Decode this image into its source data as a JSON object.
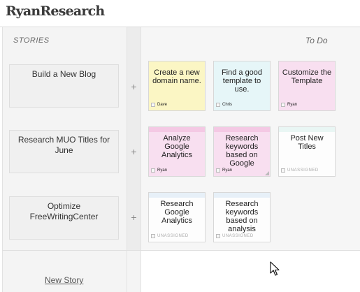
{
  "app": {
    "logo": "RyanResearch"
  },
  "board": {
    "stories_header": "STORIES",
    "todo_header": "To Do",
    "add_symbol": "+",
    "new_story_label": "New Story"
  },
  "stories": [
    {
      "title": "Build a New Blog",
      "cards": [
        {
          "text": "Create a new domain name.",
          "owner": "Dave",
          "color": "#fbf6c4"
        },
        {
          "text": "Find a good template to use.",
          "owner": "Chris",
          "color": "#e6f6f8"
        },
        {
          "text": "Customize the Template",
          "owner": "Ryan",
          "color": "#f8dff0"
        }
      ]
    },
    {
      "title": "Research MUO Titles for June",
      "cards": [
        {
          "text": "Analyze Google Analytics",
          "owner": "Ryan",
          "color": "#f8dff0"
        },
        {
          "text": "Research keywords based on Google",
          "owner": "Ryan",
          "color": "#f8dff0"
        },
        {
          "text": "Post New Titles",
          "owner": "UNASSIGNED",
          "color": "#fdfdfd"
        }
      ]
    },
    {
      "title": "Optimize FreeWritingCenter",
      "cards": [
        {
          "text": "Research Google Analytics",
          "owner": "UNASSIGNED",
          "color": "#fdfdfd"
        },
        {
          "text": "Research keywords based on analysis",
          "owner": "UNASSIGNED",
          "color": "#fdfdfd"
        }
      ]
    }
  ]
}
